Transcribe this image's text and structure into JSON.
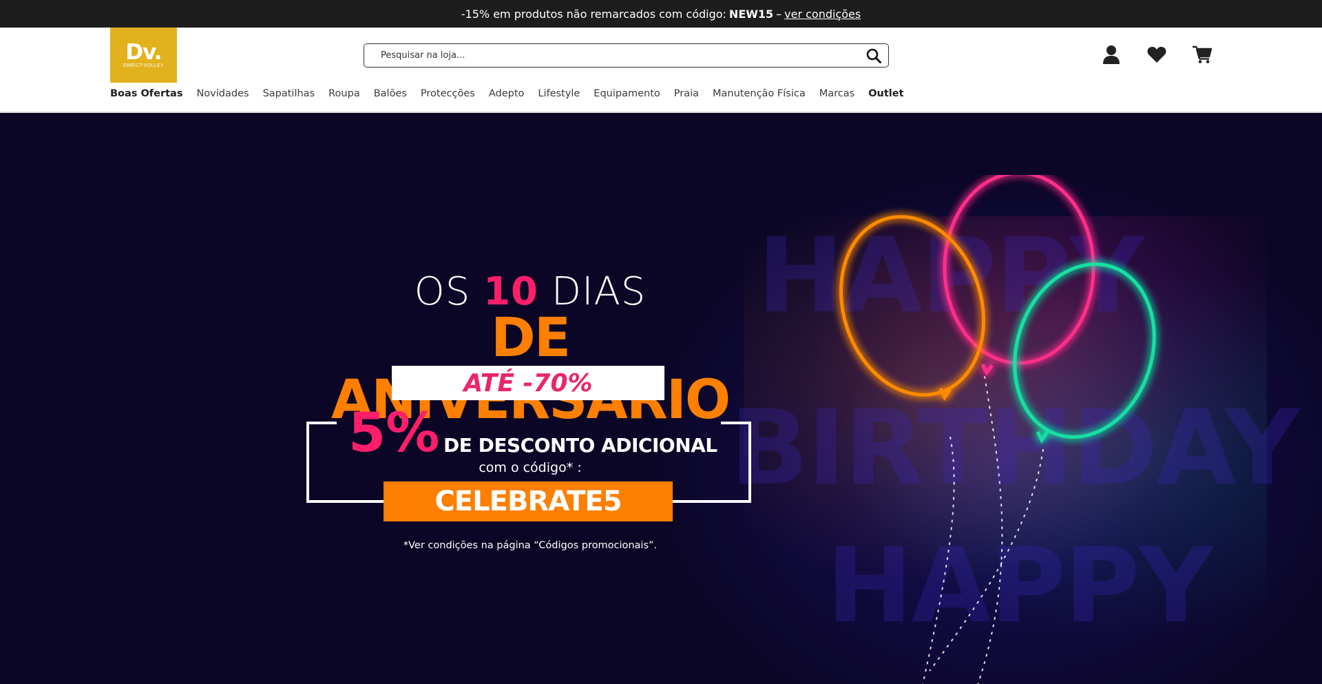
{
  "promo_bar": {
    "text": "-15% em produtos não remarcados com código:",
    "code": "NEW15",
    "separator": "–",
    "link": "ver condições"
  },
  "header": {
    "logo": {
      "mark": "Dv.",
      "sub": "DIRECT-VOLLEY",
      "color": "#e2b21e"
    },
    "search": {
      "placeholder": "Pesquisar na loja...",
      "icon": "search-icon"
    },
    "icons": [
      "account-icon",
      "heart-icon",
      "cart-icon"
    ]
  },
  "nav": {
    "items": [
      {
        "label": "Boas Ofertas",
        "bold": true
      },
      {
        "label": "Novidades"
      },
      {
        "label": "Sapatilhas"
      },
      {
        "label": "Roupa"
      },
      {
        "label": "Balões"
      },
      {
        "label": "Protecções"
      },
      {
        "label": "Adepto"
      },
      {
        "label": "Lifestyle"
      },
      {
        "label": "Equipamento"
      },
      {
        "label": "Praia"
      },
      {
        "label": "Manutenção Física"
      },
      {
        "label": "Marcas"
      },
      {
        "label": "Outlet",
        "bold": true
      }
    ]
  },
  "hero": {
    "line1_pre": "OS",
    "line1_num": "10",
    "line1_post": "DIAS",
    "line2": "DE ANIVERSÁRIO",
    "sale": "ATÉ -70%",
    "extra_pct": "5%",
    "extra_text": "DE DESCONTO ADICIONAL",
    "code_intro": "com o código* :",
    "code": "CELEBRATE5",
    "conditions": "*Ver condições na página “Códigos promocionais”.",
    "colors": {
      "orange": "#ff7f00",
      "pink": "#ff1e6a",
      "green": "#19e0a3",
      "background": "#0b0626"
    }
  }
}
